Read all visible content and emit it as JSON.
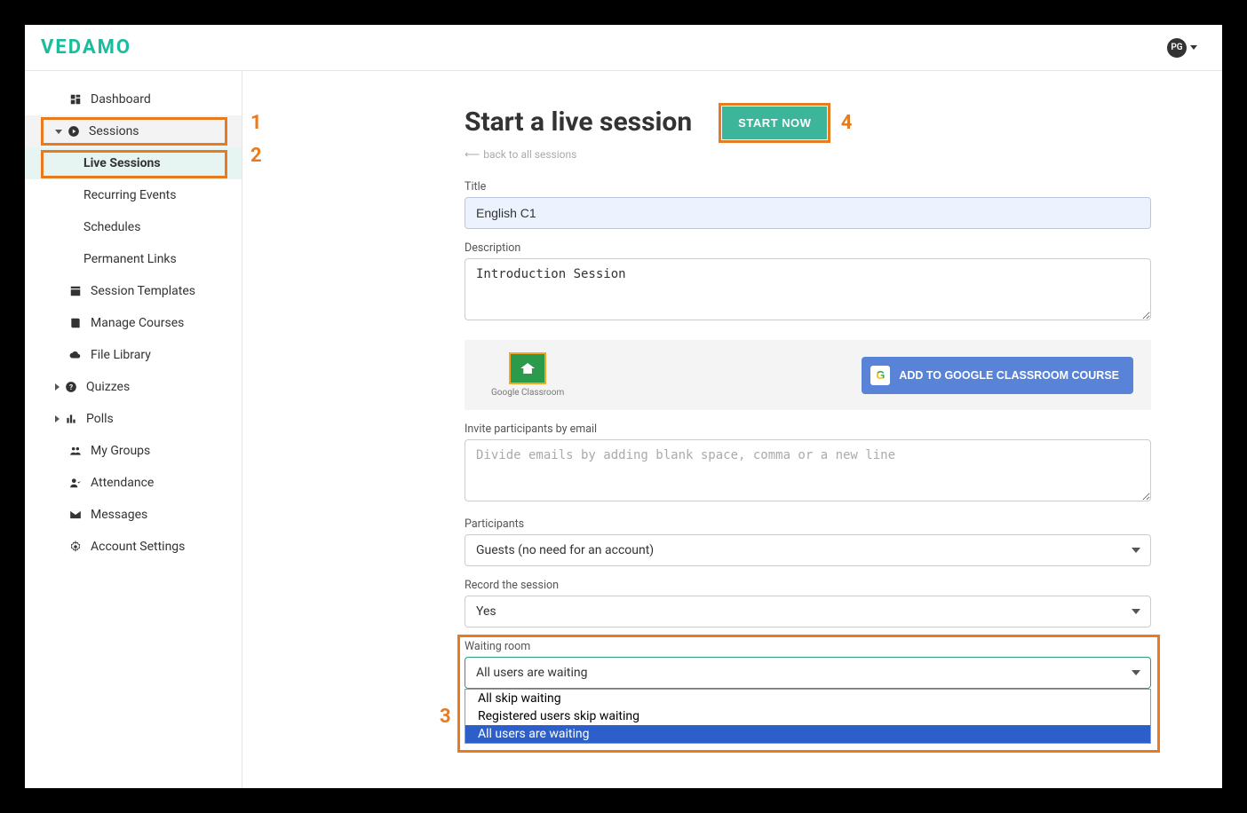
{
  "header": {
    "logo": "VEDAMO",
    "avatar_initials": "PG"
  },
  "sidebar": {
    "dashboard": "Dashboard",
    "sessions": "Sessions",
    "live_sessions": "Live Sessions",
    "recurring_events": "Recurring Events",
    "schedules": "Schedules",
    "permanent_links": "Permanent Links",
    "session_templates": "Session Templates",
    "manage_courses": "Manage Courses",
    "file_library": "File Library",
    "quizzes": "Quizzes",
    "polls": "Polls",
    "my_groups": "My Groups",
    "attendance": "Attendance",
    "messages": "Messages",
    "account_settings": "Account Settings"
  },
  "callouts": {
    "c1": "1",
    "c2": "2",
    "c3": "3",
    "c4": "4"
  },
  "main": {
    "title": "Start a live session",
    "start_now": "START NOW",
    "back_link": "back to all sessions",
    "labels": {
      "title": "Title",
      "description": "Description",
      "invite": "Invite participants by email",
      "participants": "Participants",
      "record": "Record the session",
      "waiting": "Waiting room"
    },
    "values": {
      "title": "English C1",
      "description": "Introduction Session",
      "invite_placeholder": "Divide emails by adding blank space, comma or a new line",
      "participants": "Guests (no need for an account)",
      "record": "Yes",
      "waiting_selected": "All users are waiting",
      "waiting_options": {
        "o1": "All skip waiting",
        "o2": "Registered users skip waiting",
        "o3": "All users are waiting"
      }
    },
    "google": {
      "caption": "Google Classroom",
      "button": "ADD TO GOOGLE CLASSROOM COURSE",
      "g": "G"
    }
  }
}
